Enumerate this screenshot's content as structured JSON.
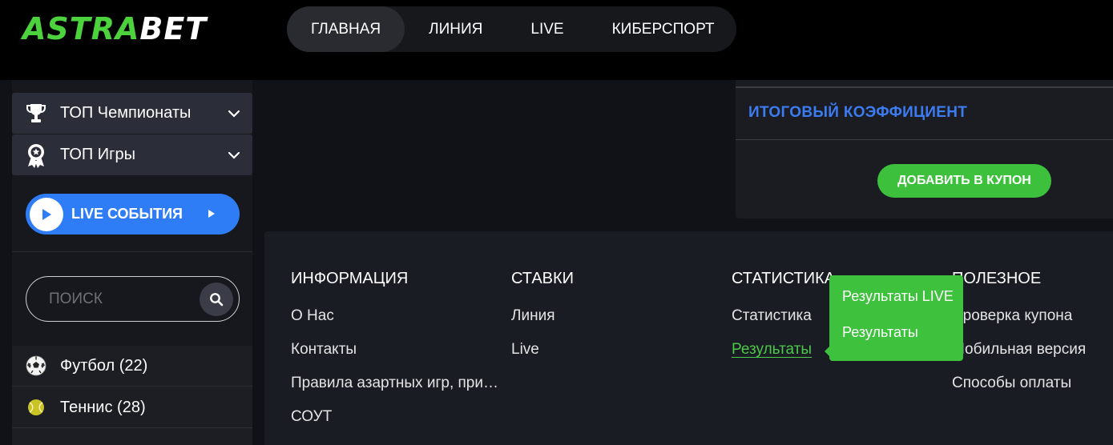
{
  "brand": {
    "part1": "ASTRA",
    "part2": "BET"
  },
  "nav": {
    "items": [
      {
        "label": "ГЛАВНАЯ"
      },
      {
        "label": "ЛИНИЯ"
      },
      {
        "label": "LIVE"
      },
      {
        "label": "КИБЕРСПОРТ"
      }
    ]
  },
  "sidebar": {
    "top_championships": "ТОП Чемпионаты",
    "top_games": "ТОП Игры",
    "live_button": "LIVE СОБЫТИЯ",
    "search_placeholder": "ПОИСК",
    "sports": [
      {
        "label": "Футбол (22)",
        "icon": "soccer-ball-icon"
      },
      {
        "label": "Теннис (28)",
        "icon": "tennis-ball-icon"
      }
    ]
  },
  "coupon": {
    "total_odds_label": "ИТОГОВЫЙ КОЭФФИЦИЕНТ",
    "add_button": "ДОБАВИТЬ В КУПОН"
  },
  "footer": {
    "columns": [
      {
        "title": "ИНФОРМАЦИЯ",
        "links": [
          "О Нас",
          "Контакты",
          "Правила азартных игр, при…",
          "СОУТ"
        ]
      },
      {
        "title": "СТАВКИ",
        "links": [
          "Линия",
          "Live"
        ]
      },
      {
        "title": "СТАТИСТИКА",
        "links": [
          "Статистика",
          "Результаты"
        ]
      },
      {
        "title": "ПОЛЕЗНОЕ",
        "links": [
          "Проверка купона",
          "Мобильная версия",
          "Способы оплаты"
        ]
      }
    ]
  },
  "results_dropdown": {
    "options": [
      "Результаты LIVE",
      "Результаты"
    ]
  },
  "colors": {
    "accent_green": "#3ec13d",
    "accent_blue": "#2e7cf6",
    "header_bg": "#000000"
  }
}
